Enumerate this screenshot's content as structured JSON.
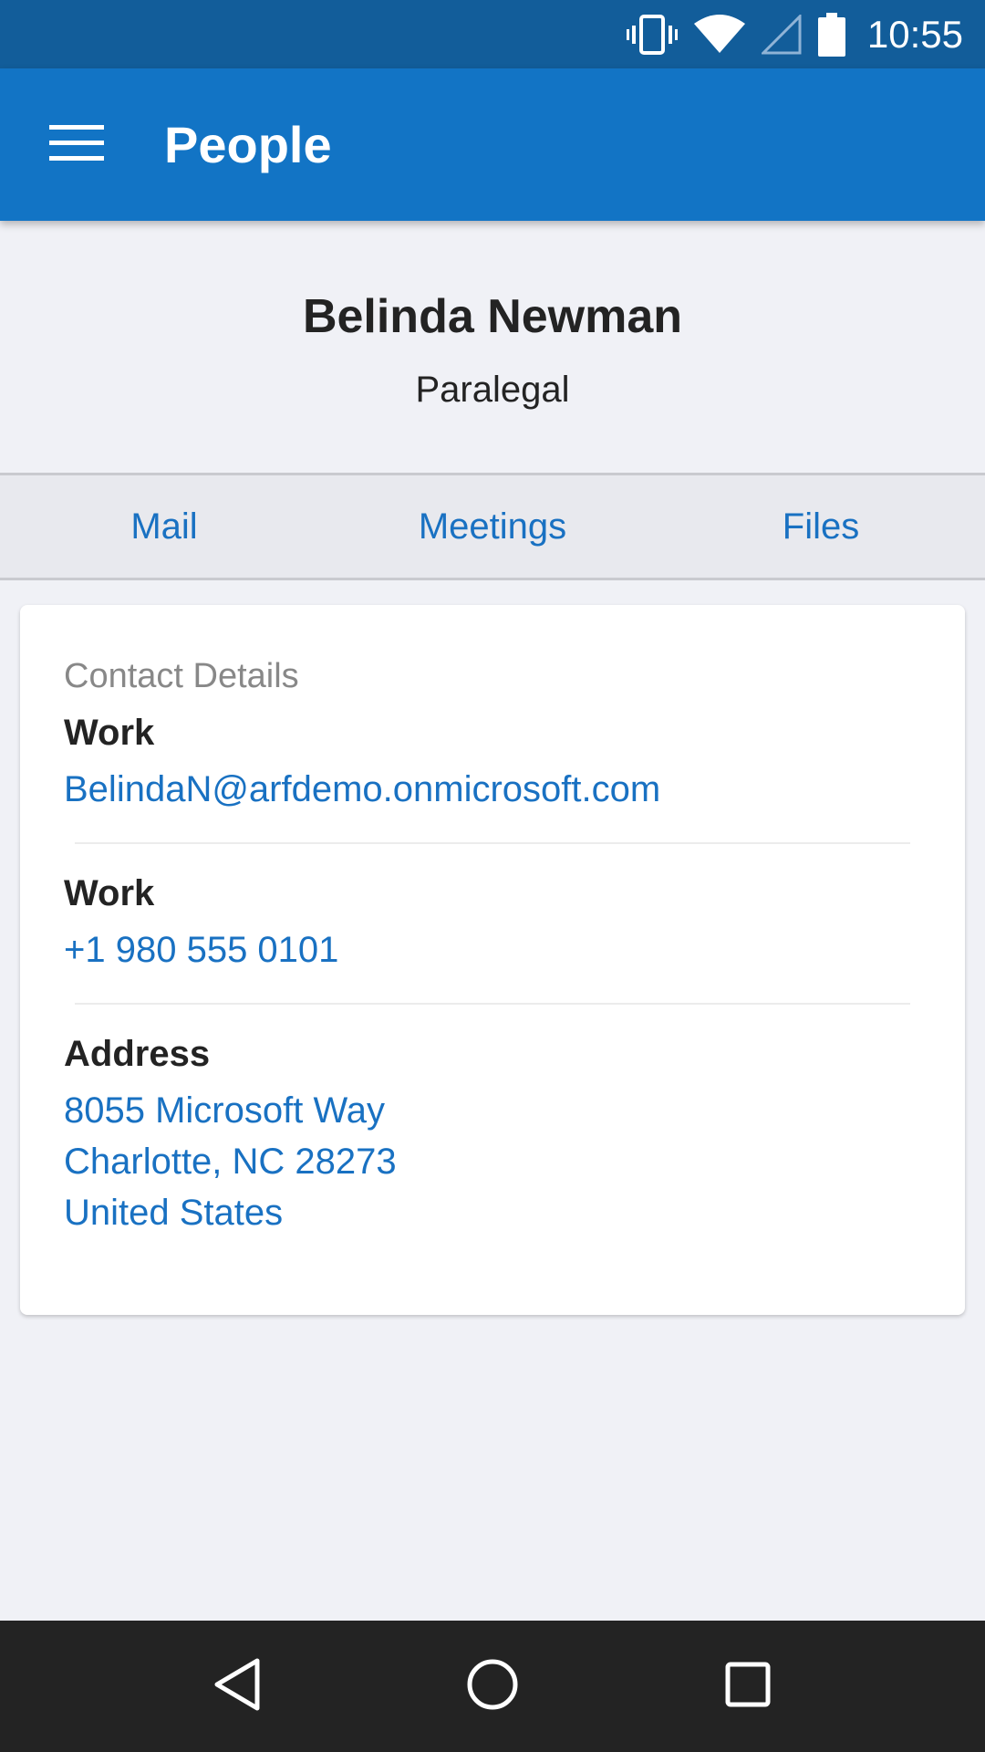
{
  "status_bar": {
    "time": "10:55",
    "icons": [
      "vibrate-icon",
      "wifi-icon",
      "cell-signal-icon",
      "battery-icon"
    ]
  },
  "app_bar": {
    "title": "People",
    "menu_icon": "hamburger-menu-icon"
  },
  "profile": {
    "name": "Belinda Newman",
    "role": "Paralegal"
  },
  "tabs": [
    {
      "label": "Mail"
    },
    {
      "label": "Meetings"
    },
    {
      "label": "Files"
    }
  ],
  "contact_card": {
    "title": "Contact Details",
    "fields": [
      {
        "label": "Work",
        "value": "BelindaN@arfdemo.onmicrosoft.com"
      },
      {
        "label": "Work",
        "value": "+1 980 555 0101"
      },
      {
        "label": "Address",
        "lines": [
          "8055 Microsoft Way",
          "Charlotte, NC 28273",
          "United States"
        ]
      }
    ]
  },
  "nav_bar": {
    "icons": [
      "back-icon",
      "home-icon",
      "recents-icon"
    ]
  },
  "colors": {
    "status_bar": "#125d9a",
    "app_bar": "#1274c5",
    "link": "#1971c2",
    "background": "#f0f1f6",
    "nav_bar": "#232323"
  }
}
